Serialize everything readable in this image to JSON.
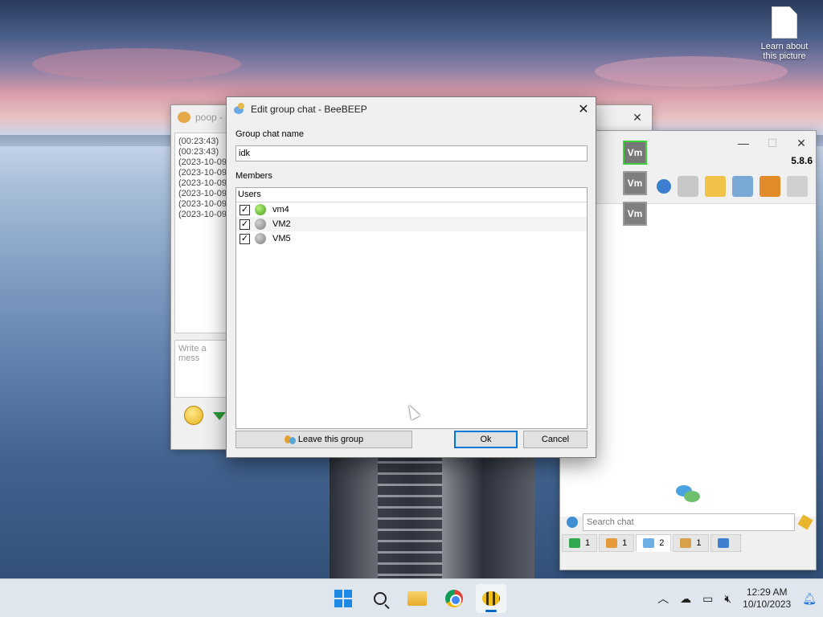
{
  "desktop": {
    "icon_label": "Learn about this picture"
  },
  "chat_window": {
    "title": "poop -",
    "log_lines": [
      "(00:23:43)",
      "(00:23:43)",
      "(2023-10-09",
      "(2023-10-09",
      "(2023-10-09",
      "(2023-10-09",
      "(2023-10-09",
      "(2023-10-09"
    ],
    "input_placeholder": "Write a mess"
  },
  "main_window": {
    "version": "5.8.6",
    "search_placeholder": "Search chat",
    "tabs": [
      {
        "count": "1"
      },
      {
        "count": "1"
      },
      {
        "count": "2"
      },
      {
        "count": "1"
      },
      {
        "count": ""
      }
    ],
    "users": [
      "Vm",
      "Vm",
      "Vm"
    ]
  },
  "dialog": {
    "title": "Edit group chat - BeeBEEP",
    "group_name_label": "Group chat name",
    "group_name_value": "idk",
    "members_label": "Members",
    "users_header": "Users",
    "members": [
      {
        "name": "vm4",
        "checked": true,
        "status": "online"
      },
      {
        "name": "VM2",
        "checked": true,
        "status": "offline"
      },
      {
        "name": "VM5",
        "checked": true,
        "status": "offline"
      }
    ],
    "leave_label": "Leave this group",
    "ok_label": "Ok",
    "cancel_label": "Cancel",
    "close_glyph": "✕"
  },
  "taskbar": {
    "time": "12:29 AM",
    "date": "10/10/2023"
  },
  "colors": {
    "accent": "#0078d7",
    "online": "#3f9e1c",
    "offline": "#7e7e7e"
  }
}
